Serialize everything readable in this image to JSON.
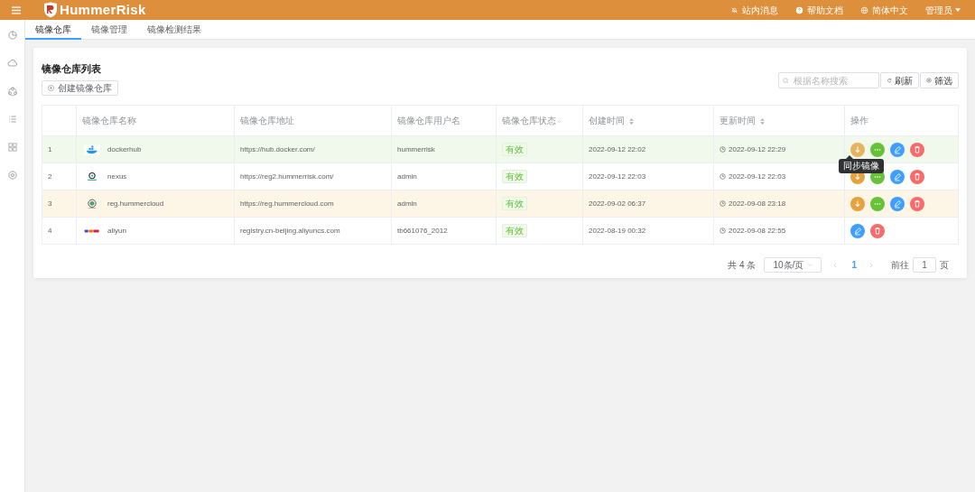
{
  "header": {
    "brand": "HummerRisk",
    "links": [
      {
        "kind": "bell",
        "label": "站内消息"
      },
      {
        "kind": "help",
        "label": "帮助文档"
      },
      {
        "kind": "globe",
        "label": "简体中文"
      }
    ],
    "user": "管理员"
  },
  "sidebar": {
    "items": [
      {
        "kind": "pie"
      },
      {
        "kind": "cloud"
      },
      {
        "kind": "cluster"
      },
      {
        "kind": "list"
      },
      {
        "kind": "grid"
      },
      {
        "kind": "gear"
      }
    ]
  },
  "tabs": [
    {
      "label": "镜像仓库",
      "selected": true
    },
    {
      "label": "镜像管理",
      "selected": false
    },
    {
      "label": "镜像检测结果",
      "selected": false
    }
  ],
  "card": {
    "title": "镜像仓库列表",
    "create_button": "创建镜像仓库",
    "search": {
      "placeholder": "根据名称搜索"
    },
    "refresh_button": "刷新",
    "filter_button": "筛选"
  },
  "table": {
    "columns": [
      {},
      {
        "label": "镜像仓库名称"
      },
      {
        "label": "镜像仓库地址"
      },
      {
        "label": "镜像仓库用户名"
      },
      {
        "label": "镜像仓库状态",
        "filter": true
      },
      {
        "label": "创建时间",
        "sort": true
      },
      {
        "label": "更新时间",
        "sort": true
      },
      {
        "label": "操作"
      }
    ],
    "rows": [
      {
        "index": "1",
        "name": "dockerhub",
        "address": "https://hub.docker.com/",
        "username": "hummerrisk",
        "status": "有效",
        "created": "2022-09-12 22:02",
        "updated": "2022-09-12 22:29",
        "hovered": true,
        "selected": false,
        "actions": [
          {
            "kind": "sync"
          },
          {
            "kind": "more"
          },
          {
            "kind": "edit"
          },
          {
            "kind": "delete"
          }
        ]
      },
      {
        "index": "2",
        "name": "nexus",
        "address": "https://reg2.hummerrisk.com/",
        "username": "admin",
        "status": "有效",
        "created": "2022-09-12 22:03",
        "updated": "2022-09-12 22:03",
        "hovered": false,
        "selected": false,
        "actions": [
          {
            "kind": "sync"
          },
          {
            "kind": "more"
          },
          {
            "kind": "edit"
          },
          {
            "kind": "delete"
          }
        ]
      },
      {
        "index": "3",
        "name": "reg.hummercloud",
        "address": "https://reg.hummercloud.com",
        "username": "admin",
        "status": "有效",
        "created": "2022-09-02 06:37",
        "updated": "2022-09-08 23:18",
        "hovered": false,
        "selected": true,
        "actions": [
          {
            "kind": "sync"
          },
          {
            "kind": "more"
          },
          {
            "kind": "edit"
          },
          {
            "kind": "delete"
          }
        ]
      },
      {
        "index": "4",
        "name": "aliyun",
        "address": "registry.cn-beijing.aliyuncs.com",
        "username": "tb661076_2012",
        "status": "有效",
        "created": "2022-08-19 00:32",
        "updated": "2022-09-08 22:55",
        "hovered": false,
        "selected": false,
        "actions": [
          {
            "kind": "edit"
          },
          {
            "kind": "delete"
          }
        ]
      }
    ]
  },
  "tooltip": "同步镜像",
  "pagination": {
    "total": "共 4 条",
    "page_size": "10条/页",
    "pages": [
      {
        "label": "1",
        "selected": true
      }
    ],
    "goto_label": "前往",
    "goto_value": "1",
    "page_unit": "页"
  }
}
